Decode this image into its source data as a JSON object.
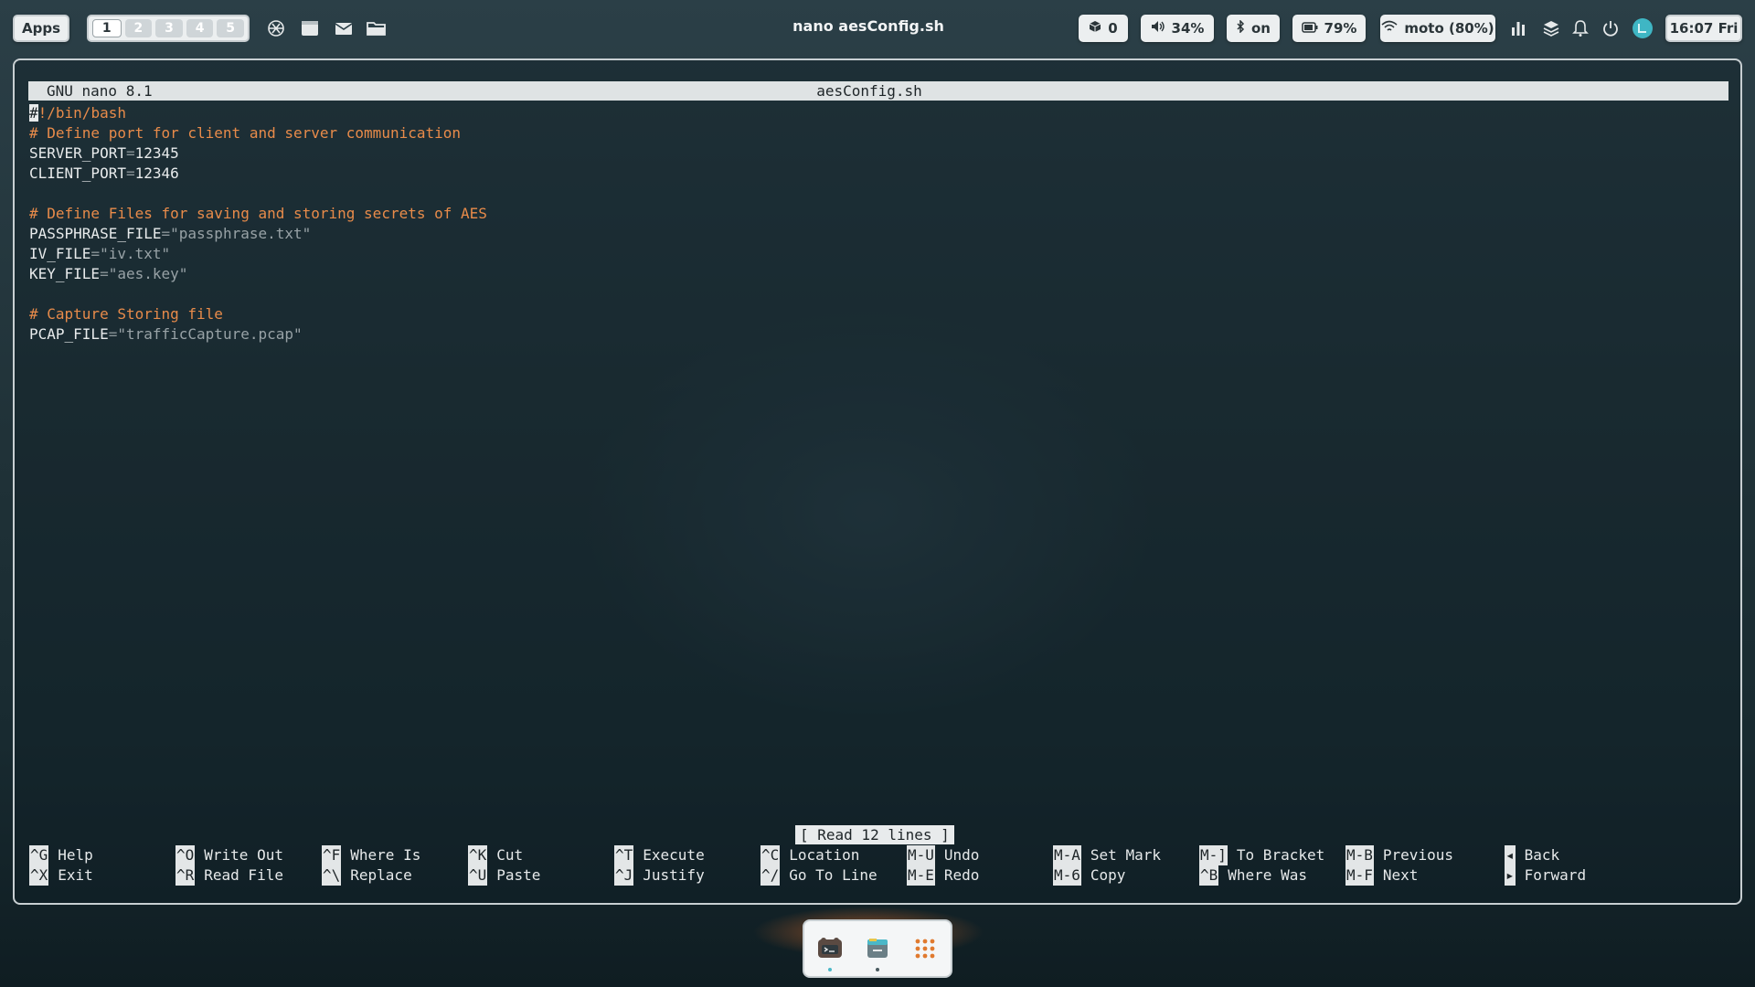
{
  "topbar": {
    "apps_label": "Apps",
    "workspaces": [
      "1",
      "2",
      "3",
      "4",
      "5"
    ],
    "active_workspace": "1",
    "launchers": [
      "chatgpt-icon",
      "window-icon",
      "mail-icon",
      "folder-icon"
    ],
    "window_title": "nano aesConfig.sh",
    "status": {
      "packages": "0",
      "volume": "34%",
      "bluetooth": "on",
      "battery": "79%",
      "wifi": "moto (80%)"
    },
    "clock": "16:07 Fri"
  },
  "nano": {
    "version": "GNU nano 8.1",
    "filename": "aesConfig.sh",
    "lines": {
      "l1_cursor": "#",
      "l1_rest": "!/bin/bash",
      "l2": "# Define port for client and server communication",
      "l3_name": "SERVER_PORT",
      "l3_eq": "=",
      "l3_val": "12345",
      "l4_name": "CLIENT_PORT",
      "l4_eq": "=",
      "l4_val": "12346",
      "l6": "# Define Files for saving and storing secrets of AES",
      "l7_name": "PASSPHRASE_FILE",
      "l7_eq": "=",
      "l7_val": "\"passphrase.txt\"",
      "l8_name": "IV_FILE",
      "l8_eq": "=",
      "l8_val": "\"iv.txt\"",
      "l9_name": "KEY_FILE",
      "l9_eq": "=",
      "l9_val": "\"aes.key\"",
      "l11": "# Capture Storing file",
      "l12_name": "PCAP_FILE",
      "l12_eq": "=",
      "l12_val": "\"trafficCapture.pcap\""
    },
    "status_message": "[ Read 12 lines ]",
    "shortcuts": [
      {
        "key": "^G",
        "label": "Help"
      },
      {
        "key": "^X",
        "label": "Exit"
      },
      {
        "key": "^O",
        "label": "Write Out"
      },
      {
        "key": "^R",
        "label": "Read File"
      },
      {
        "key": "^F",
        "label": "Where Is"
      },
      {
        "key": "^\\",
        "label": "Replace"
      },
      {
        "key": "^K",
        "label": "Cut"
      },
      {
        "key": "^U",
        "label": "Paste"
      },
      {
        "key": "^T",
        "label": "Execute"
      },
      {
        "key": "^J",
        "label": "Justify"
      },
      {
        "key": "^C",
        "label": "Location"
      },
      {
        "key": "^/",
        "label": "Go To Line"
      },
      {
        "key": "M-U",
        "label": "Undo"
      },
      {
        "key": "M-E",
        "label": "Redo"
      },
      {
        "key": "M-A",
        "label": "Set Mark"
      },
      {
        "key": "M-6",
        "label": "Copy"
      },
      {
        "key": "M-]",
        "label": "To Bracket"
      },
      {
        "key": "^B",
        "label": "Where Was"
      },
      {
        "key": "M-B",
        "label": "Previous"
      },
      {
        "key": "M-F",
        "label": "Next"
      },
      {
        "key": "◂",
        "label": "Back"
      },
      {
        "key": "▸",
        "label": "Forward"
      }
    ]
  },
  "dock": {
    "items": [
      "terminal-icon",
      "file-manager-icon",
      "app-grid-icon"
    ]
  },
  "colors": {
    "accent_comment": "#e88b4a",
    "bar_pill": "#eceff0",
    "avatar": "#3fb6c4"
  }
}
